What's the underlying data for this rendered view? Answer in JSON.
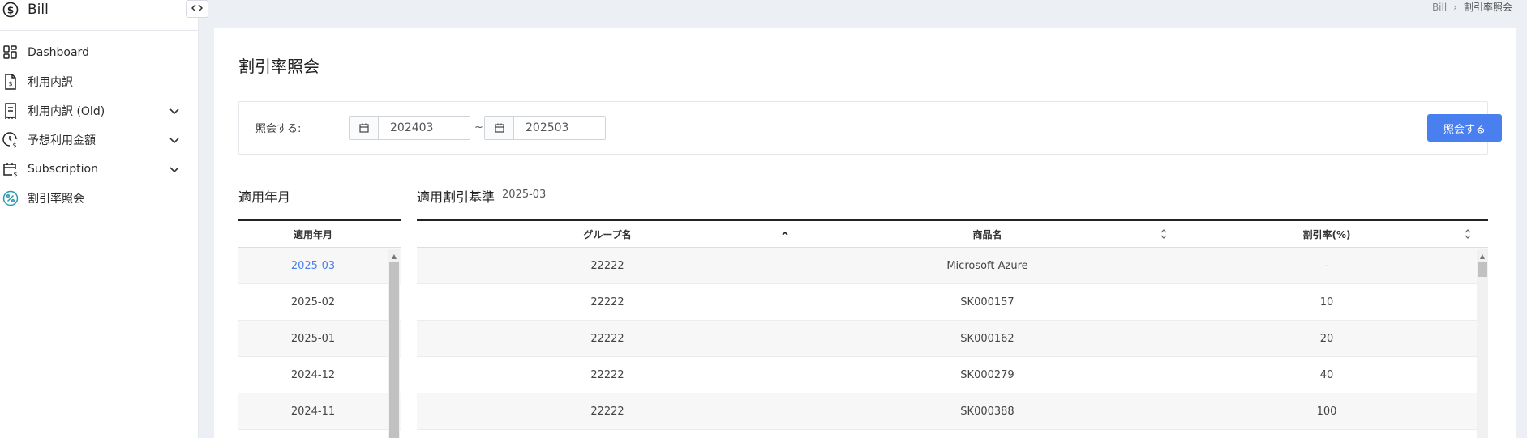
{
  "app": {
    "title": "Bill"
  },
  "sidebar": {
    "items": [
      {
        "label": "Dashboard"
      },
      {
        "label": "利用内訳"
      },
      {
        "label": "利用内訳 (Old)"
      },
      {
        "label": "予想利用金額"
      },
      {
        "label": "Subscription"
      },
      {
        "label": "割引率照会"
      }
    ]
  },
  "breadcrumb": {
    "root": "Bill",
    "separator": "›",
    "current": "割引率照会"
  },
  "page": {
    "title": "割引率照会"
  },
  "filter": {
    "label": "照会する:",
    "from": "202403",
    "separator": "~",
    "to": "202503",
    "button": "照会する"
  },
  "left_panel": {
    "title": "適用年月",
    "column": "適用年月",
    "rows": [
      "2025-03",
      "2025-02",
      "2025-01",
      "2024-12",
      "2024-11"
    ]
  },
  "right_panel": {
    "title": "適用割引基準",
    "period": "2025-03",
    "columns": [
      "グループ名",
      "商品名",
      "割引率(%)"
    ],
    "rows": [
      [
        "22222",
        "Microsoft Azure",
        "-"
      ],
      [
        "22222",
        "SK000157",
        "10"
      ],
      [
        "22222",
        "SK000162",
        "20"
      ],
      [
        "22222",
        "SK000279",
        "40"
      ],
      [
        "22222",
        "SK000388",
        "100"
      ]
    ]
  },
  "colors": {
    "accent": "#4a7ff0",
    "background": "#eceff3"
  }
}
